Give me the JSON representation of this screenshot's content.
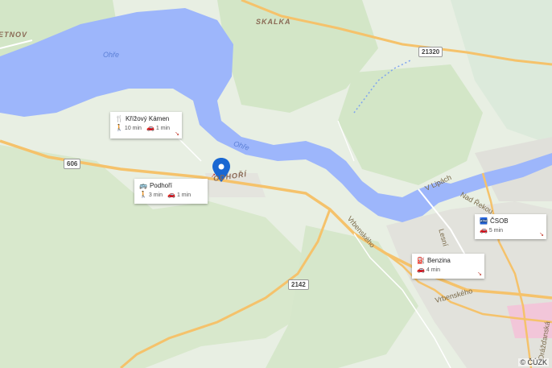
{
  "map": {
    "copyright": "© ČÚZK",
    "colors": {
      "water": "#9db6fb",
      "land": "#e8efe3",
      "forest": "#d3e6c7",
      "road": "#f5c26b",
      "urban": "#ddddd8",
      "marker": "#1967d2"
    },
    "rivers": [
      {
        "label": "Ohře",
        "key": "ohre1"
      },
      {
        "label": "Ohře",
        "key": "ohre2"
      }
    ],
    "places": {
      "skalka": "SKALKA",
      "detnov": "ETNOV",
      "podhori": "ODHOŘÍ"
    },
    "roads": {
      "r606": "606",
      "r21320": "21320",
      "r2142": "2142"
    },
    "streets": {
      "v_lipach": "V Lipách",
      "nad_rekou": "Nad Řekou",
      "vrbenskeho1": "Vrbenského",
      "vrbenskeho2": "Vrbenského",
      "lesni": "Lesní",
      "drazdanska": "Drážďanská"
    }
  },
  "cards": {
    "krizovy": {
      "title": "Křížový Kámen",
      "walk": "10 min",
      "car": "1 min",
      "icon": "restaurant-icon"
    },
    "podhori": {
      "title": "Podhoří",
      "walk": "3 min",
      "car": "1 min",
      "icon": "bus-stop-icon"
    },
    "csob": {
      "title": "ČSOB",
      "car": "5 min",
      "icon": "atm-icon"
    },
    "benzina": {
      "title": "Benzina",
      "car": "4 min",
      "icon": "fuel-station-icon"
    }
  }
}
